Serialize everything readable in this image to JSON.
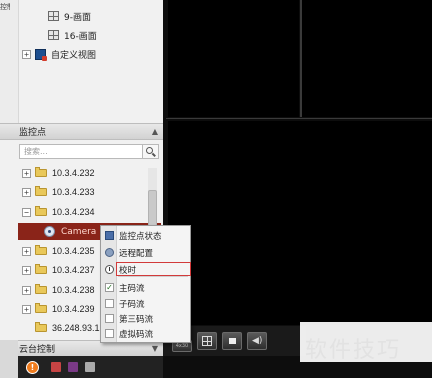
{
  "top_cut_text": "控制",
  "view_list": {
    "items": [
      {
        "label": "9-画面"
      },
      {
        "label": "16-画面"
      }
    ],
    "custom_view": {
      "expander": "+",
      "label": "自定义视图"
    }
  },
  "monitor_section": {
    "title": "监控点",
    "collapse_arrow": "▲",
    "search_placeholder": "搜索...",
    "tree": [
      {
        "expander": "+",
        "label": "10.3.4.232"
      },
      {
        "expander": "+",
        "label": "10.3.4.233"
      },
      {
        "expander": "−",
        "label": "10.3.4.234"
      },
      {
        "label": "Camera 1"
      },
      {
        "expander": "+",
        "label": "10.3.4.235"
      },
      {
        "expander": "+",
        "label": "10.3.4.237"
      },
      {
        "expander": "+",
        "label": "10.3.4.238"
      },
      {
        "expander": "+",
        "label": "10.3.4.239"
      },
      {
        "label": "36.248.93.12"
      }
    ]
  },
  "ptz_section": {
    "title": "云台控制",
    "expand_arrow": "▼"
  },
  "context_menu": {
    "items": [
      {
        "label": "监控点状态"
      },
      {
        "label": "远程配置"
      },
      {
        "label": "校时"
      },
      {
        "label": "主码流",
        "checked": true,
        "check_mark": "✓"
      },
      {
        "label": "子码流",
        "checked": false
      },
      {
        "label": "第三码流",
        "checked": false
      },
      {
        "label": "虚拟码流",
        "checked": false
      }
    ],
    "highlight_color": "#d23a3a"
  },
  "toolbar": {
    "small_label": "4x30"
  },
  "status_bar": {
    "alert_symbol": "!"
  },
  "watermark": "软件技巧",
  "colors": {
    "selected_row": "#8a2419",
    "video_bg": "#000000",
    "panel_bg": "#f1f1f1"
  }
}
